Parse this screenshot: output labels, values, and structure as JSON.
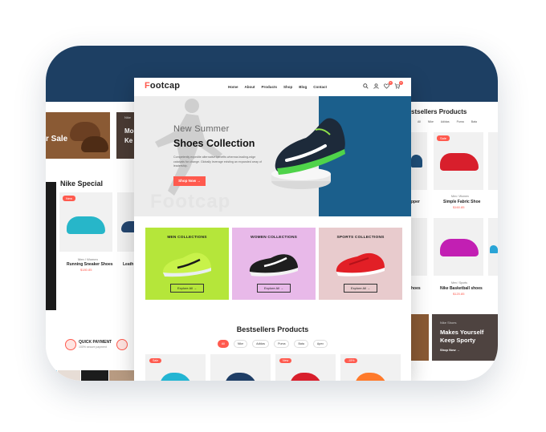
{
  "colors": {
    "accent": "#ff5a4e",
    "frame_band": "#1d3f63",
    "hero_blue": "#1b5f8c",
    "men_bg": "#b5e63a",
    "women_bg": "#e8b9e9",
    "sports_bg": "#e8cbcd"
  },
  "main": {
    "logo_first": "F",
    "logo_rest": "ootcap",
    "nav": [
      "Home",
      "About",
      "Products",
      "Shop",
      "Blog",
      "Contact"
    ],
    "icons": [
      "search-icon",
      "user-icon",
      "heart-icon",
      "cart-icon"
    ],
    "wishlist_count": "0",
    "cart_count": "0",
    "hero": {
      "subtitle": "New Summer",
      "title": "Shoes Collection",
      "text": "Competently expedite alternative benefits whereas leading-edge catalysts for change. Globally leverage existing an expanded array of leadership.",
      "button": "Shop Now →",
      "watermark": "Footcap"
    },
    "collections": [
      {
        "title": "MEN COLLECTIONS",
        "button": "Explore All →"
      },
      {
        "title": "WOMEN COLLECTIONS",
        "button": "Explore All →"
      },
      {
        "title": "SPORTS COLLECTIONS",
        "button": "Explore All →"
      }
    ],
    "bestsellers": {
      "title": "Bestsellers Products",
      "filters": [
        "All",
        "Nike",
        "Adidas",
        "Puma",
        "Bata",
        "Apex"
      ],
      "badges": [
        "Sale",
        "",
        "New",
        "-15%"
      ]
    }
  },
  "left_page": {
    "banner_text": "r Sale",
    "banner2_tiny": "Nike",
    "banner2_big": "Mo Ke",
    "section_title": "Nike Special",
    "card_badge": "New",
    "card_category": "Men / Women",
    "card_name": "Running Sneaker Shoes",
    "card_price": "$180.85",
    "card2_name": "Leath",
    "pay_title": "QUICK PAYMENT",
    "pay_sub": "100% secure payment"
  },
  "right_page": {
    "title": "stsellers Products",
    "filters": [
      "All",
      "Nike",
      "Adidas",
      "Puma",
      "Bata",
      "Apex"
    ],
    "badge": "Sale",
    "card1_category": "Men / Women",
    "card1_name": "Simple Fabric Shoe",
    "card1_price": "$160.85",
    "card1_left_name": "pper",
    "card2_category": "Men / Sports",
    "card2_name": "Nike Basketball shoes",
    "card2_price": "$120.85",
    "card2_left_name": "hoes",
    "promo_tiny": "Nike Shoes",
    "promo_big_1": "Makes Yourself",
    "promo_big_2": "Keep Sporty",
    "promo_link": "Shop Now →"
  }
}
